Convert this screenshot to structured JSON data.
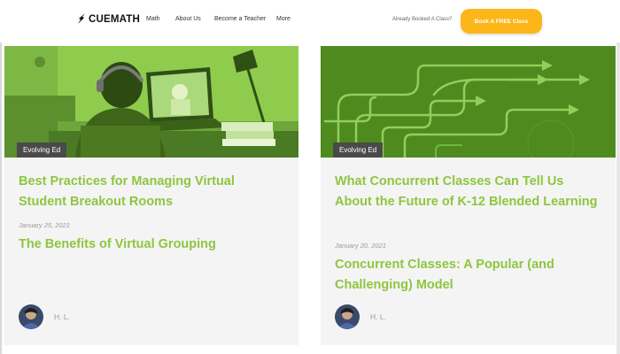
{
  "header": {
    "logo_text": "CUEMATH",
    "nav": [
      "Math",
      "About Us",
      "Become a Teacher",
      "More"
    ],
    "booked_text": "Already Booked A Class?",
    "cta_label": "Book A FREE Class",
    "cta_color": "#fcb619"
  },
  "cards": [
    {
      "tag": "Evolving Ed",
      "title": "Best Practices for Managing Virtual Student Breakout Rooms",
      "date": "January 25, 2021",
      "subtitle": "The Benefits of Virtual Grouping",
      "author": "H. L."
    },
    {
      "tag": "Evolving Ed",
      "title": "What Concurrent Classes Can Tell Us About the Future of K-12 Blended Learning",
      "date": "January 20, 2021",
      "subtitle": "Concurrent Classes: A Popular (and Challenging) Model",
      "author": "H. L."
    }
  ],
  "colors": {
    "accent_green": "#8dc63f",
    "tag_bg": "#4a4a4a",
    "card_bg": "#f4f4f4"
  }
}
